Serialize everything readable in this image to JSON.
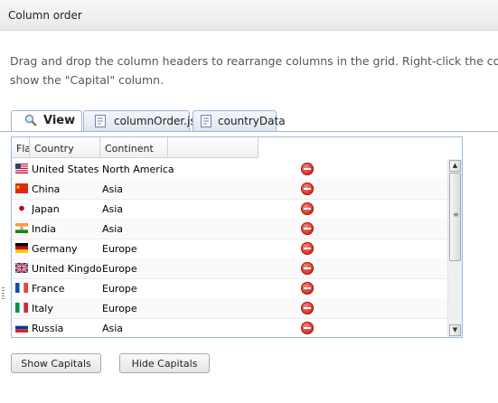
{
  "window": {
    "title": "Column order"
  },
  "description": [
    "Drag and drop the column headers to rearrange columns in the grid. Right-click the column",
    "show the \"Capital\" column."
  ],
  "tabs": [
    {
      "label": "View",
      "icon": "magnifier-icon"
    },
    {
      "label": "columnOrder.js",
      "icon": "script-file-icon"
    },
    {
      "label": "countryData",
      "icon": "script-file-icon"
    }
  ],
  "grid": {
    "columns": [
      "Fla",
      "Country",
      "Continent"
    ],
    "rows": [
      {
        "flag": "us",
        "country": "United States",
        "continent": "North America"
      },
      {
        "flag": "cn",
        "country": "China",
        "continent": "Asia"
      },
      {
        "flag": "jp",
        "country": "Japan",
        "continent": "Asia"
      },
      {
        "flag": "in",
        "country": "India",
        "continent": "Asia"
      },
      {
        "flag": "de",
        "country": "Germany",
        "continent": "Europe"
      },
      {
        "flag": "gb",
        "country": "United Kingdom",
        "continent": "Europe"
      },
      {
        "flag": "fr",
        "country": "France",
        "continent": "Europe"
      },
      {
        "flag": "it",
        "country": "Italy",
        "continent": "Europe"
      },
      {
        "flag": "ru",
        "country": "Russia",
        "continent": "Asia"
      }
    ],
    "row_action_icon": "remove-icon"
  },
  "buttons": {
    "show_capitals": "Show Capitals",
    "hide_capitals": "Hide Capitals"
  },
  "colors": {
    "grid_border": "#99bbe8",
    "tab_border": "#9eb6ce",
    "remove_red": "#d9342a"
  }
}
